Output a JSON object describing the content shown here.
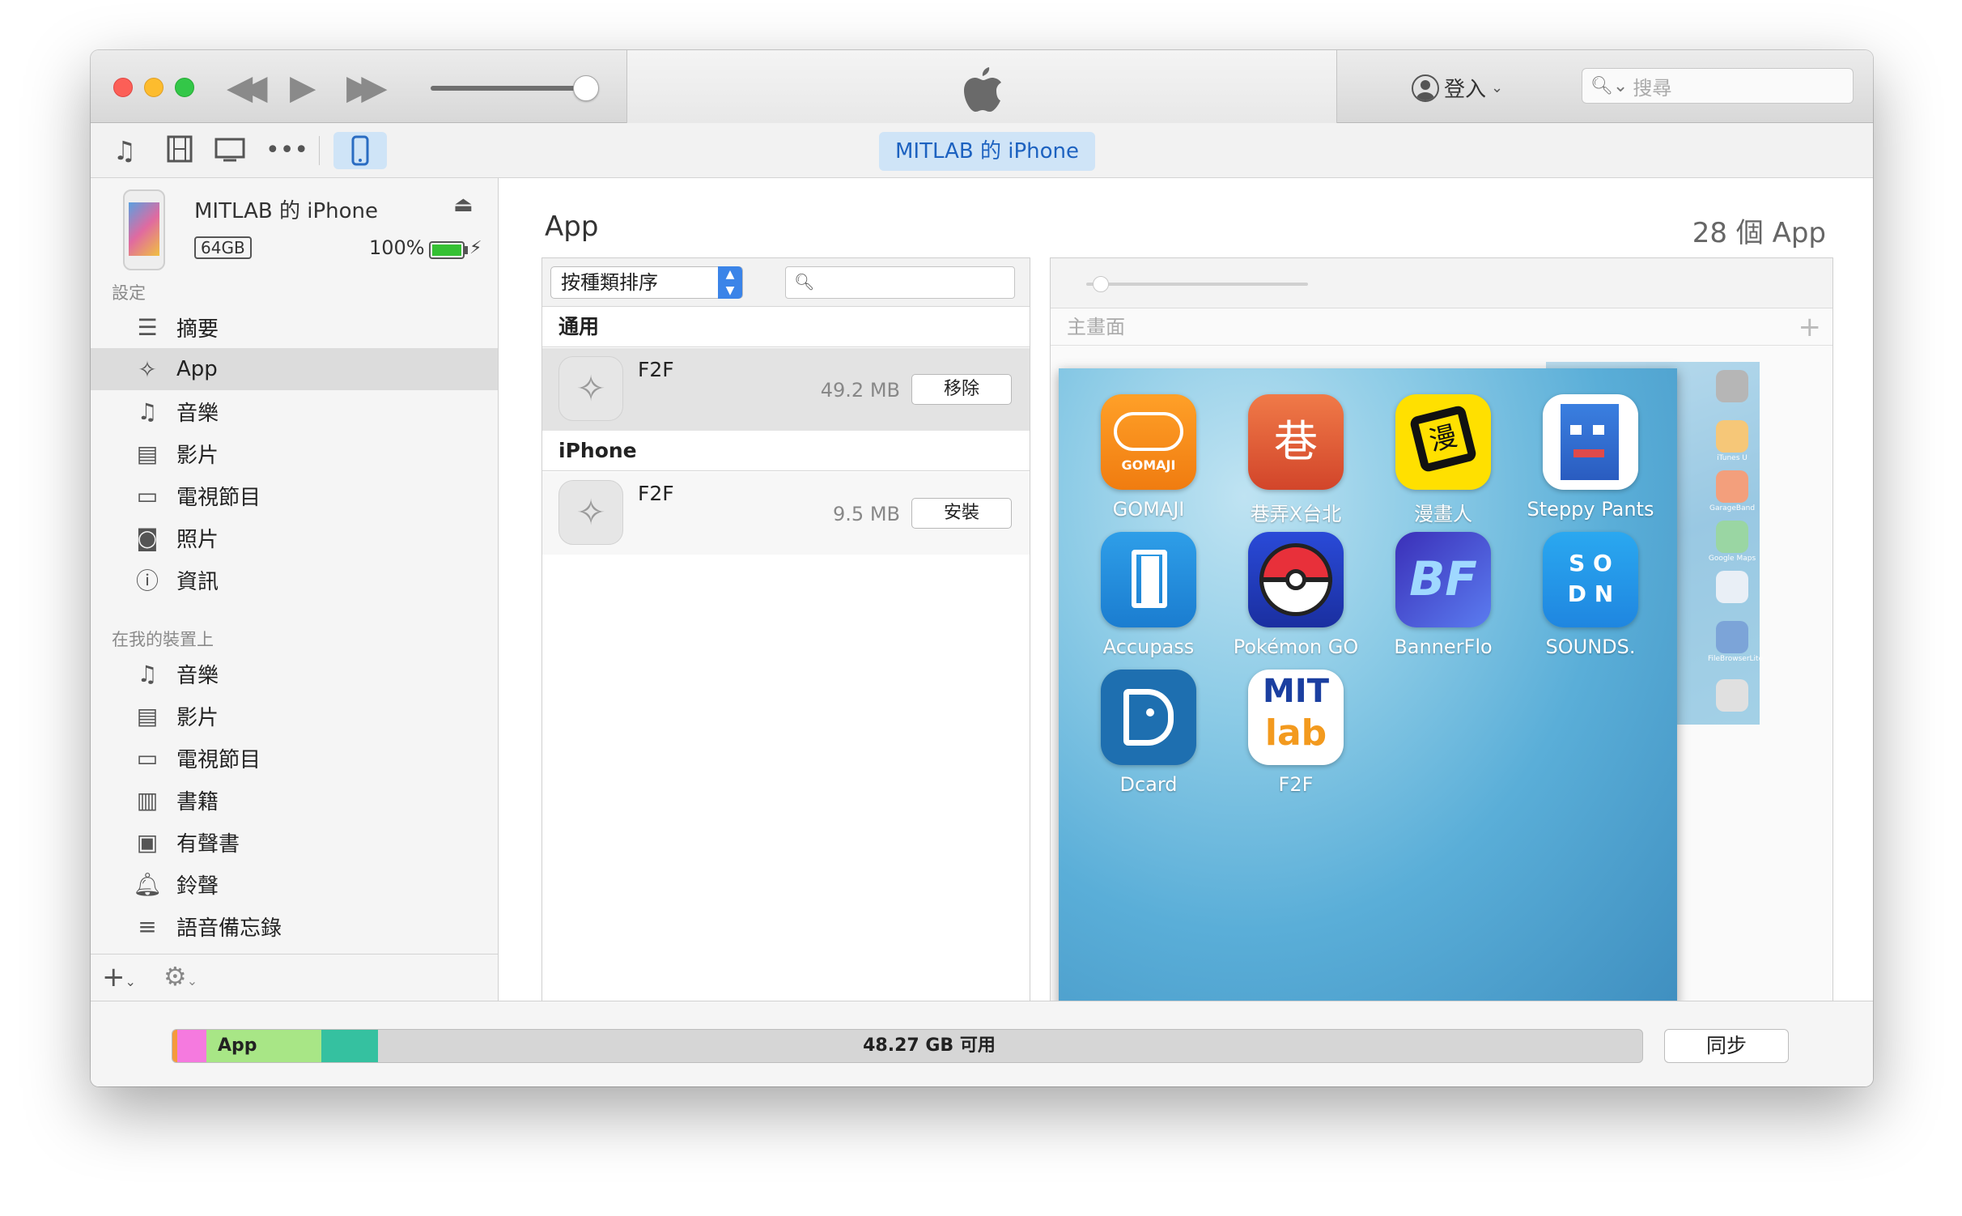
{
  "titlebar": {
    "account_label": "登入",
    "search_placeholder": "搜尋"
  },
  "toolbar": {
    "device_tab": "MITLAB 的 iPhone"
  },
  "sidebar": {
    "device_name": "MITLAB 的 iPhone",
    "capacity": "64GB",
    "battery": "100%",
    "settings_header": "設定",
    "settings_items": [
      {
        "label": "摘要",
        "icon": "summary-icon"
      },
      {
        "label": "App",
        "icon": "app-store-icon"
      },
      {
        "label": "音樂",
        "icon": "music-icon"
      },
      {
        "label": "影片",
        "icon": "film-icon"
      },
      {
        "label": "電視節目",
        "icon": "tv-icon"
      },
      {
        "label": "照片",
        "icon": "camera-icon"
      },
      {
        "label": "資訊",
        "icon": "info-icon"
      }
    ],
    "on_device_header": "在我的裝置上",
    "on_device_items": [
      {
        "label": "音樂",
        "icon": "music-icon"
      },
      {
        "label": "影片",
        "icon": "film-icon"
      },
      {
        "label": "電視節目",
        "icon": "tv-icon"
      },
      {
        "label": "書籍",
        "icon": "book-icon"
      },
      {
        "label": "有聲書",
        "icon": "audiobook-icon"
      },
      {
        "label": "鈴聲",
        "icon": "bell-icon"
      },
      {
        "label": "語音備忘錄",
        "icon": "voice-memo-icon"
      }
    ]
  },
  "main": {
    "title": "App",
    "app_count": "28 個 App",
    "sort_label": "按種類排序",
    "groups": [
      {
        "header": "通用",
        "apps": [
          {
            "name": "F2F",
            "size": "49.2 MB",
            "action": "移除"
          }
        ]
      },
      {
        "header": "iPhone",
        "apps": [
          {
            "name": "F2F",
            "size": "9.5 MB",
            "action": "安裝"
          }
        ]
      }
    ],
    "home_screen_label": "主畫面",
    "home_apps": [
      {
        "label": "GOMAJI"
      },
      {
        "label": "巷弄X台北"
      },
      {
        "label": "漫畫人"
      },
      {
        "label": "Steppy Pants"
      },
      {
        "label": "Accupass"
      },
      {
        "label": "Pokémon GO"
      },
      {
        "label": "BannerFlo"
      },
      {
        "label": "SOUNDS."
      },
      {
        "label": "Dcard"
      },
      {
        "label": "F2F"
      }
    ],
    "page2_labels": [
      "iTunes U",
      "GarageBand",
      "Google Maps",
      "FileBrowserLite"
    ]
  },
  "storage": {
    "app_label": "App",
    "free_label": "48.27 GB 可用",
    "sync_label": "同步",
    "colors": {
      "other": "#f59a3c",
      "photos": "#f57adf",
      "app": "#a8e686",
      "docs": "#35c1a0",
      "free": "#d6d6d6"
    }
  }
}
